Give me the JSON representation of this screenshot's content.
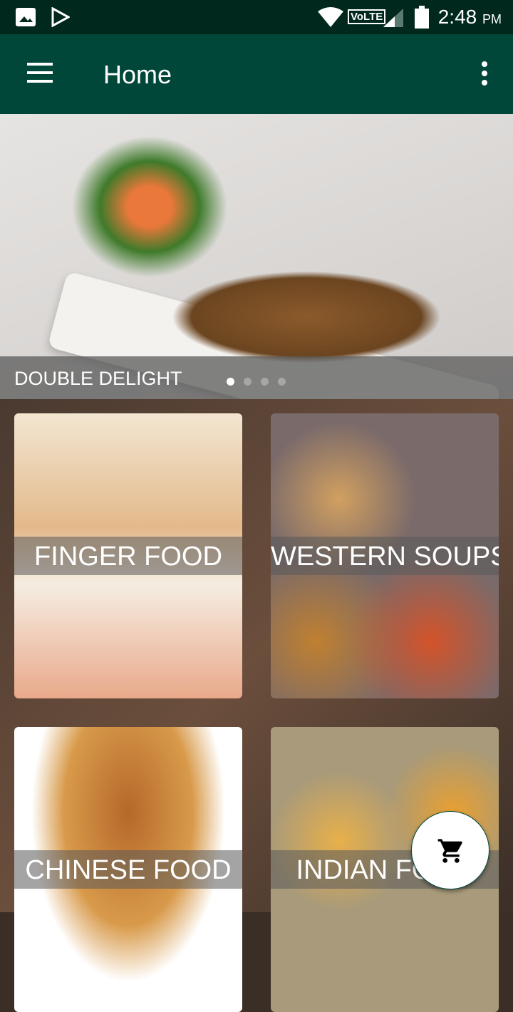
{
  "status_bar": {
    "time": "2:48",
    "ampm": "PM",
    "network": "VoLTE"
  },
  "app_bar": {
    "title": "Home"
  },
  "banner": {
    "caption": "DOUBLE DELIGHT",
    "slide_count": 4,
    "active_slide": 1
  },
  "categories": [
    {
      "label": "FINGER FOOD",
      "color": "#e8c9a0"
    },
    {
      "label": "WESTERN SOUPS",
      "color": "#8a6a4a"
    },
    {
      "label": "CHINESE FOOD",
      "color": "#c07a3a"
    },
    {
      "label": "INDIAN FOOD",
      "color": "#a8904a"
    }
  ]
}
